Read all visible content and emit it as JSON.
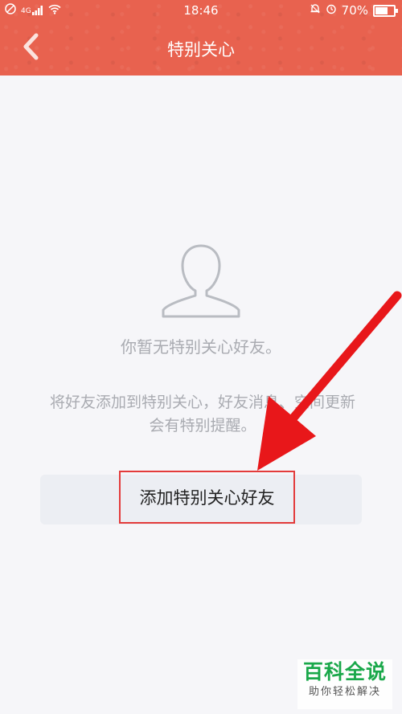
{
  "status_bar": {
    "time": "18:46",
    "signal_label": "4G",
    "battery_percent": "70%"
  },
  "header": {
    "title": "特别关心",
    "back_icon": "chevron-left-icon"
  },
  "empty_state": {
    "icon": "person-silhouette-icon",
    "title": "你暂无特别关心好友。",
    "description_line1": "将好友添加到特别关心，好友消息、空间更新",
    "description_line2": "会有特别提醒。"
  },
  "actions": {
    "add_button_label": "添加特别关心好友"
  },
  "annotation": {
    "arrow_color": "#e8171a",
    "highlight_color": "#e33b3b"
  },
  "watermark": {
    "title": "百科全说",
    "subtitle": "助你轻松解决"
  },
  "colors": {
    "header_bg": "#e8624f",
    "page_bg": "#f6f6f9",
    "muted_text": "#a9abb1"
  }
}
